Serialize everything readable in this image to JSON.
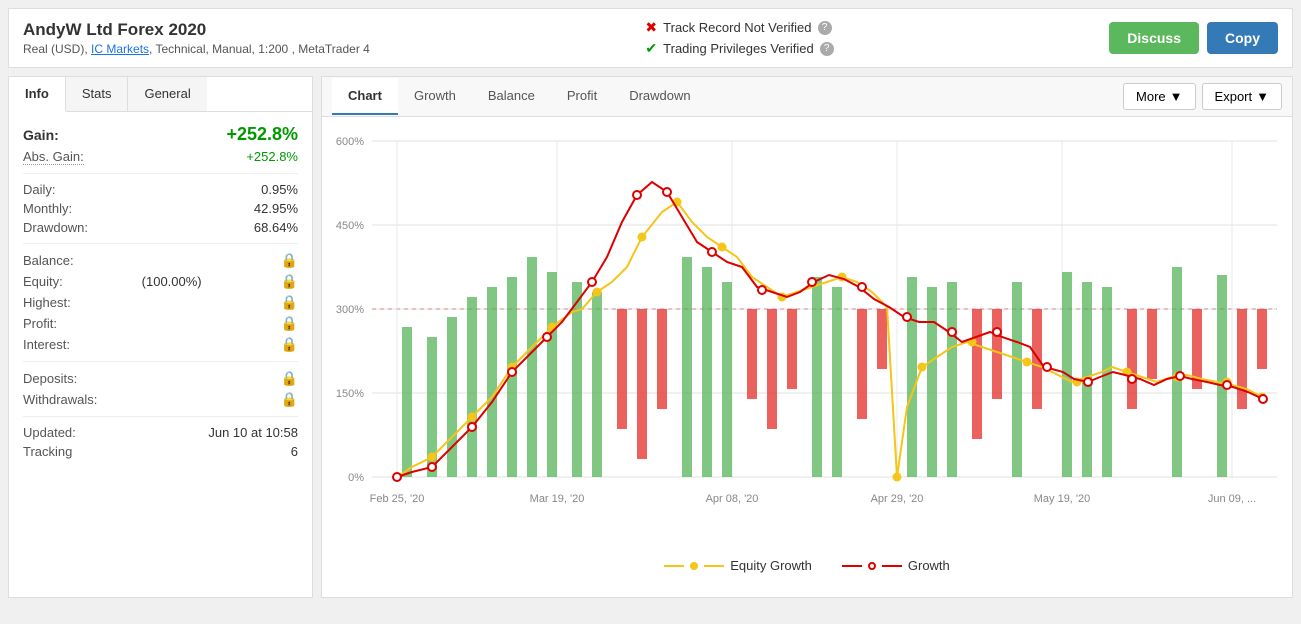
{
  "header": {
    "title": "AndyW Ltd Forex 2020",
    "subtitle": "Real (USD), IC Markets, Technical, Manual, 1:200 , MetaTrader 4",
    "track_record": "Track Record Not Verified",
    "trading_privileges": "Trading Privileges Verified",
    "btn_discuss": "Discuss",
    "btn_copy": "Copy"
  },
  "left_panel": {
    "tabs": [
      "Info",
      "Stats",
      "General"
    ],
    "active_tab": "Info",
    "gain_label": "Gain:",
    "gain_value": "+252.8%",
    "abs_gain_label": "Abs. Gain:",
    "abs_gain_value": "+252.8%",
    "daily_label": "Daily:",
    "daily_value": "0.95%",
    "monthly_label": "Monthly:",
    "monthly_value": "42.95%",
    "drawdown_label": "Drawdown:",
    "drawdown_value": "68.64%",
    "balance_label": "Balance:",
    "equity_label": "Equity:",
    "equity_value": "(100.00%)",
    "highest_label": "Highest:",
    "profit_label": "Profit:",
    "interest_label": "Interest:",
    "deposits_label": "Deposits:",
    "withdrawals_label": "Withdrawals:",
    "updated_label": "Updated:",
    "updated_value": "Jun 10 at 10:58",
    "tracking_label": "Tracking",
    "tracking_value": "6"
  },
  "chart_panel": {
    "tabs": [
      "Chart",
      "Growth",
      "Balance",
      "Profit",
      "Drawdown"
    ],
    "active_tab": "Chart",
    "btn_more": "More",
    "btn_export": "Export",
    "y_labels": [
      "600%",
      "450%",
      "300%",
      "150%",
      "0%"
    ],
    "x_labels": [
      "Feb 25, '20",
      "Mar 19, '20",
      "Apr 08, '20",
      "Apr 29, '20",
      "May 19, '20",
      "Jun 09, ..."
    ],
    "legend_equity": "Equity Growth",
    "legend_growth": "Growth"
  }
}
